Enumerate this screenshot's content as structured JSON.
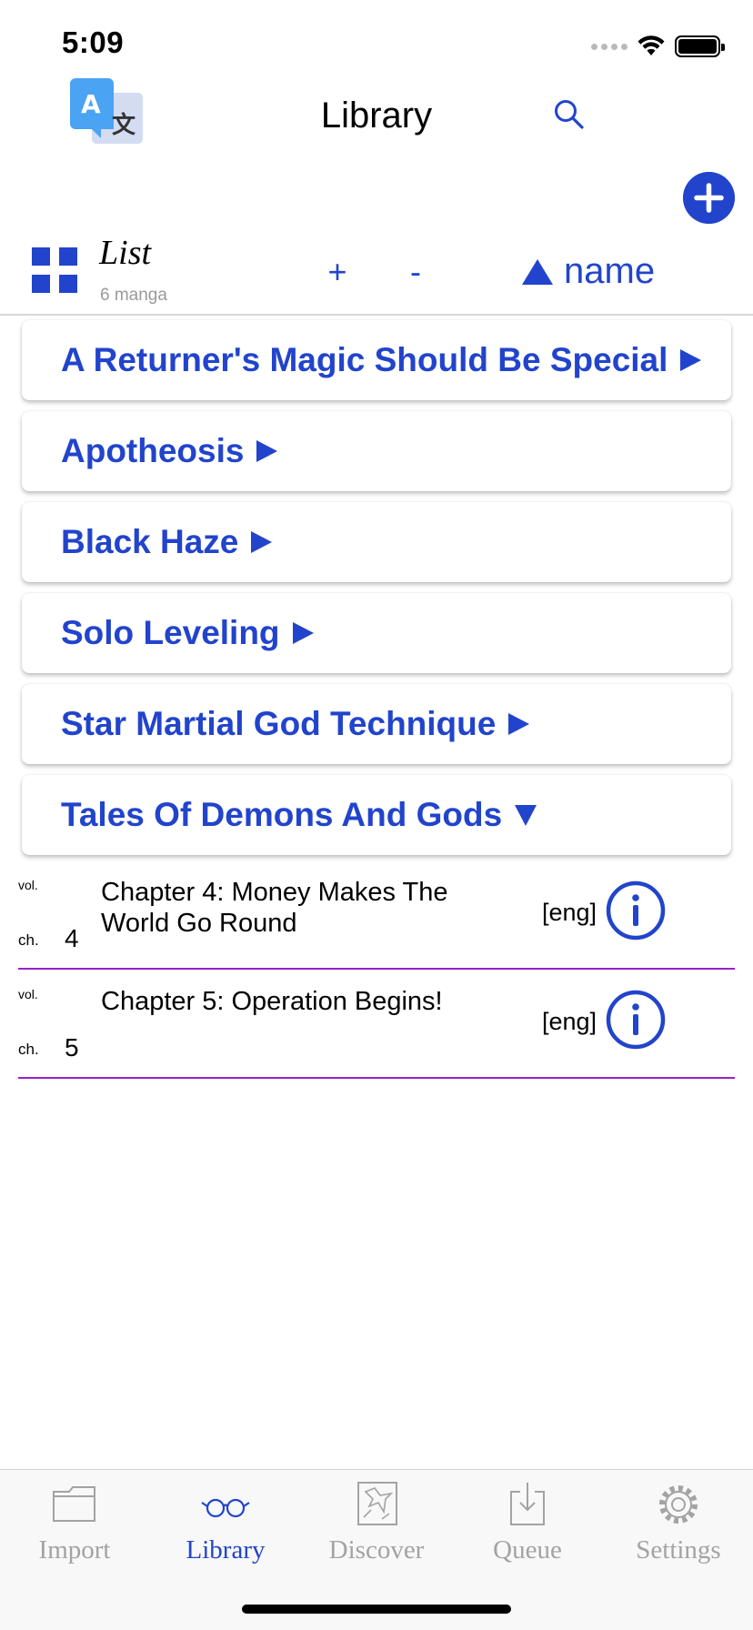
{
  "status_bar": {
    "time": "5:09"
  },
  "header": {
    "title": "Library"
  },
  "toolbar": {
    "view_mode": "List",
    "manga_count": "6 manga",
    "zoom_in_label": "+",
    "zoom_out_label": "-",
    "sort_label": "name"
  },
  "manga_list": [
    {
      "title": "A Returner's Magic Should Be Special",
      "expanded": false
    },
    {
      "title": "Apotheosis",
      "expanded": false
    },
    {
      "title": "Black Haze",
      "expanded": false
    },
    {
      "title": "Solo Leveling",
      "expanded": false
    },
    {
      "title": "Star Martial God Technique",
      "expanded": false
    },
    {
      "title": "Tales Of Demons And Gods",
      "expanded": true
    }
  ],
  "chapters": [
    {
      "vol_label": "vol.",
      "ch_label": "ch.",
      "ch_number": "4",
      "title": "Chapter 4: Money Makes The World Go Round",
      "lang": "[eng]"
    },
    {
      "vol_label": "vol.",
      "ch_label": "ch.",
      "ch_number": "5",
      "title": "Chapter 5: Operation Begins!",
      "lang": "[eng]"
    }
  ],
  "tab_bar": {
    "tabs": [
      {
        "label": "Import",
        "icon": "folder-icon",
        "active": false
      },
      {
        "label": "Library",
        "icon": "glasses-icon",
        "active": true
      },
      {
        "label": "Discover",
        "icon": "discover-icon",
        "active": false
      },
      {
        "label": "Queue",
        "icon": "download-icon",
        "active": false
      },
      {
        "label": "Settings",
        "icon": "gear-icon",
        "active": false
      }
    ]
  },
  "colors": {
    "accent": "#2244cc",
    "divider": "#9b1fc9",
    "inactive_tab": "#a3a3a3"
  }
}
